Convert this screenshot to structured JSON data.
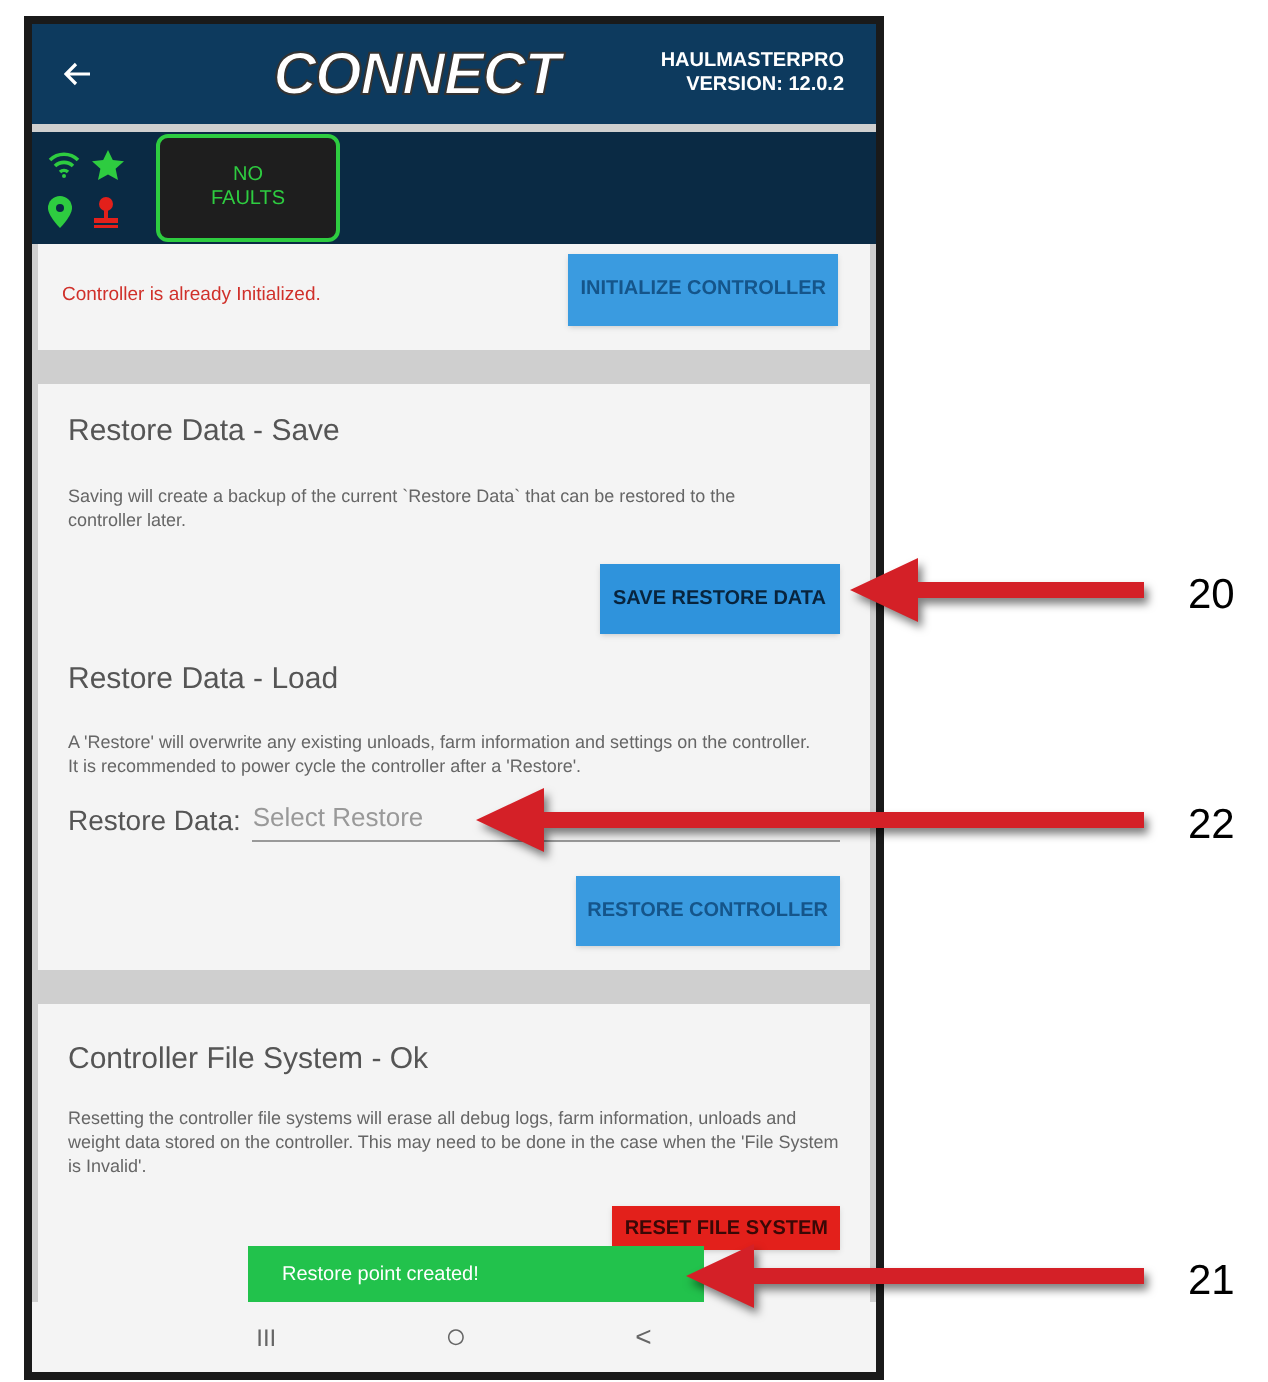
{
  "header": {
    "logo": "CONNECT",
    "app_name": "HAULMASTERPRO",
    "version": "VERSION: 12.0.2"
  },
  "status": {
    "faults": "NO FAULTS"
  },
  "initialize": {
    "message": "Controller is already Initialized.",
    "button": "INITIALIZE CONTROLLER",
    "disabled": true
  },
  "restore_save": {
    "title": "Restore Data - Save",
    "description": "Saving will create a backup of the current `Restore Data` that can be restored to the controller later.",
    "button": "SAVE RESTORE DATA",
    "disabled": false
  },
  "restore_load": {
    "title": "Restore Data - Load",
    "description": "A 'Restore' will overwrite any existing unloads, farm information and settings on the controller. It is recommended to power cycle the controller after a 'Restore'.",
    "field_label": "Restore Data:",
    "placeholder": "Select Restore",
    "button": "RESTORE CONTROLLER",
    "disabled": true
  },
  "file_system": {
    "title": "Controller File System - Ok",
    "description": "Resetting the controller file systems will erase all debug logs, farm information, unloads and weight data stored on the controller. This may need to be done in the case when the 'File System is Invalid'.",
    "button": "RESET FILE SYSTEM",
    "disabled": false
  },
  "toast": "Restore point created!",
  "nav_bar": {
    "recents": "III",
    "home": "○",
    "back": "<"
  },
  "callouts": [
    {
      "label": "20"
    },
    {
      "label": "22"
    },
    {
      "label": "21"
    }
  ]
}
